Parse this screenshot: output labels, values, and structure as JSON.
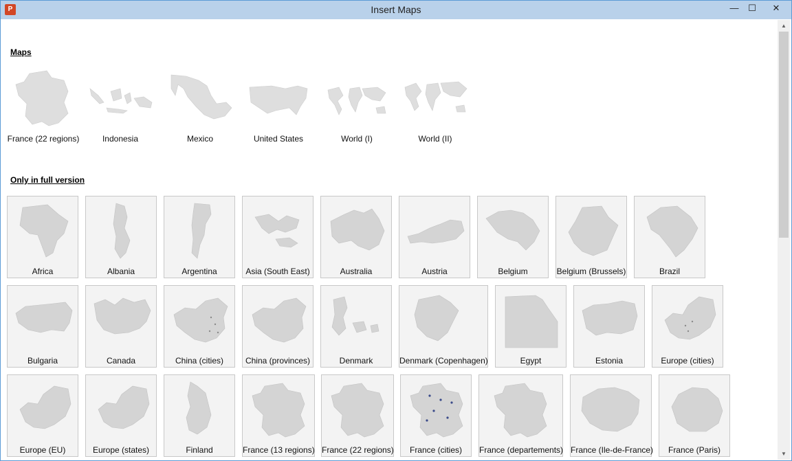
{
  "window": {
    "title": "Insert Maps",
    "app_icon": "powerpoint-icon",
    "minimize_glyph": "—",
    "maximize_glyph": "☐",
    "close_glyph": "✕"
  },
  "sections": {
    "maps_title": "Maps",
    "full_version_title": "Only in full version"
  },
  "free_maps": [
    {
      "label": "France (22 regions)",
      "icon": "france-map-icon"
    },
    {
      "label": "Indonesia",
      "icon": "indonesia-map-icon"
    },
    {
      "label": "Mexico",
      "icon": "mexico-map-icon"
    },
    {
      "label": "United States",
      "icon": "united-states-map-icon"
    },
    {
      "label": "World (I)",
      "icon": "world-map-icon"
    },
    {
      "label": "World (II)",
      "icon": "world-map-icon"
    }
  ],
  "full_maps_row1": [
    {
      "label": "Africa"
    },
    {
      "label": "Albania"
    },
    {
      "label": "Argentina"
    },
    {
      "label": "Asia (South East)"
    },
    {
      "label": "Australia"
    },
    {
      "label": "Austria"
    },
    {
      "label": "Belgium"
    },
    {
      "label": "Belgium (Brussels)"
    },
    {
      "label": "Brazil"
    }
  ],
  "full_maps_row2": [
    {
      "label": "Bulgaria"
    },
    {
      "label": "Canada"
    },
    {
      "label": "China (cities)"
    },
    {
      "label": "China (provinces)"
    },
    {
      "label": "Denmark"
    },
    {
      "label": "Denmark (Copenhagen)"
    },
    {
      "label": "Egypt"
    },
    {
      "label": "Estonia"
    },
    {
      "label": "Europe (cities)"
    }
  ],
  "full_maps_row3": [
    {
      "label": "Europe (EU)"
    },
    {
      "label": "Europe (states)"
    },
    {
      "label": "Finland"
    },
    {
      "label": "France (13 regions)"
    },
    {
      "label": "France (22 regions)"
    },
    {
      "label": "France (cities)"
    },
    {
      "label": "France (departements)"
    },
    {
      "label": "France (Ile-de-France)"
    },
    {
      "label": "France (Paris)"
    }
  ],
  "scrollbar": {
    "up_glyph": "▲",
    "down_glyph": "▼"
  }
}
